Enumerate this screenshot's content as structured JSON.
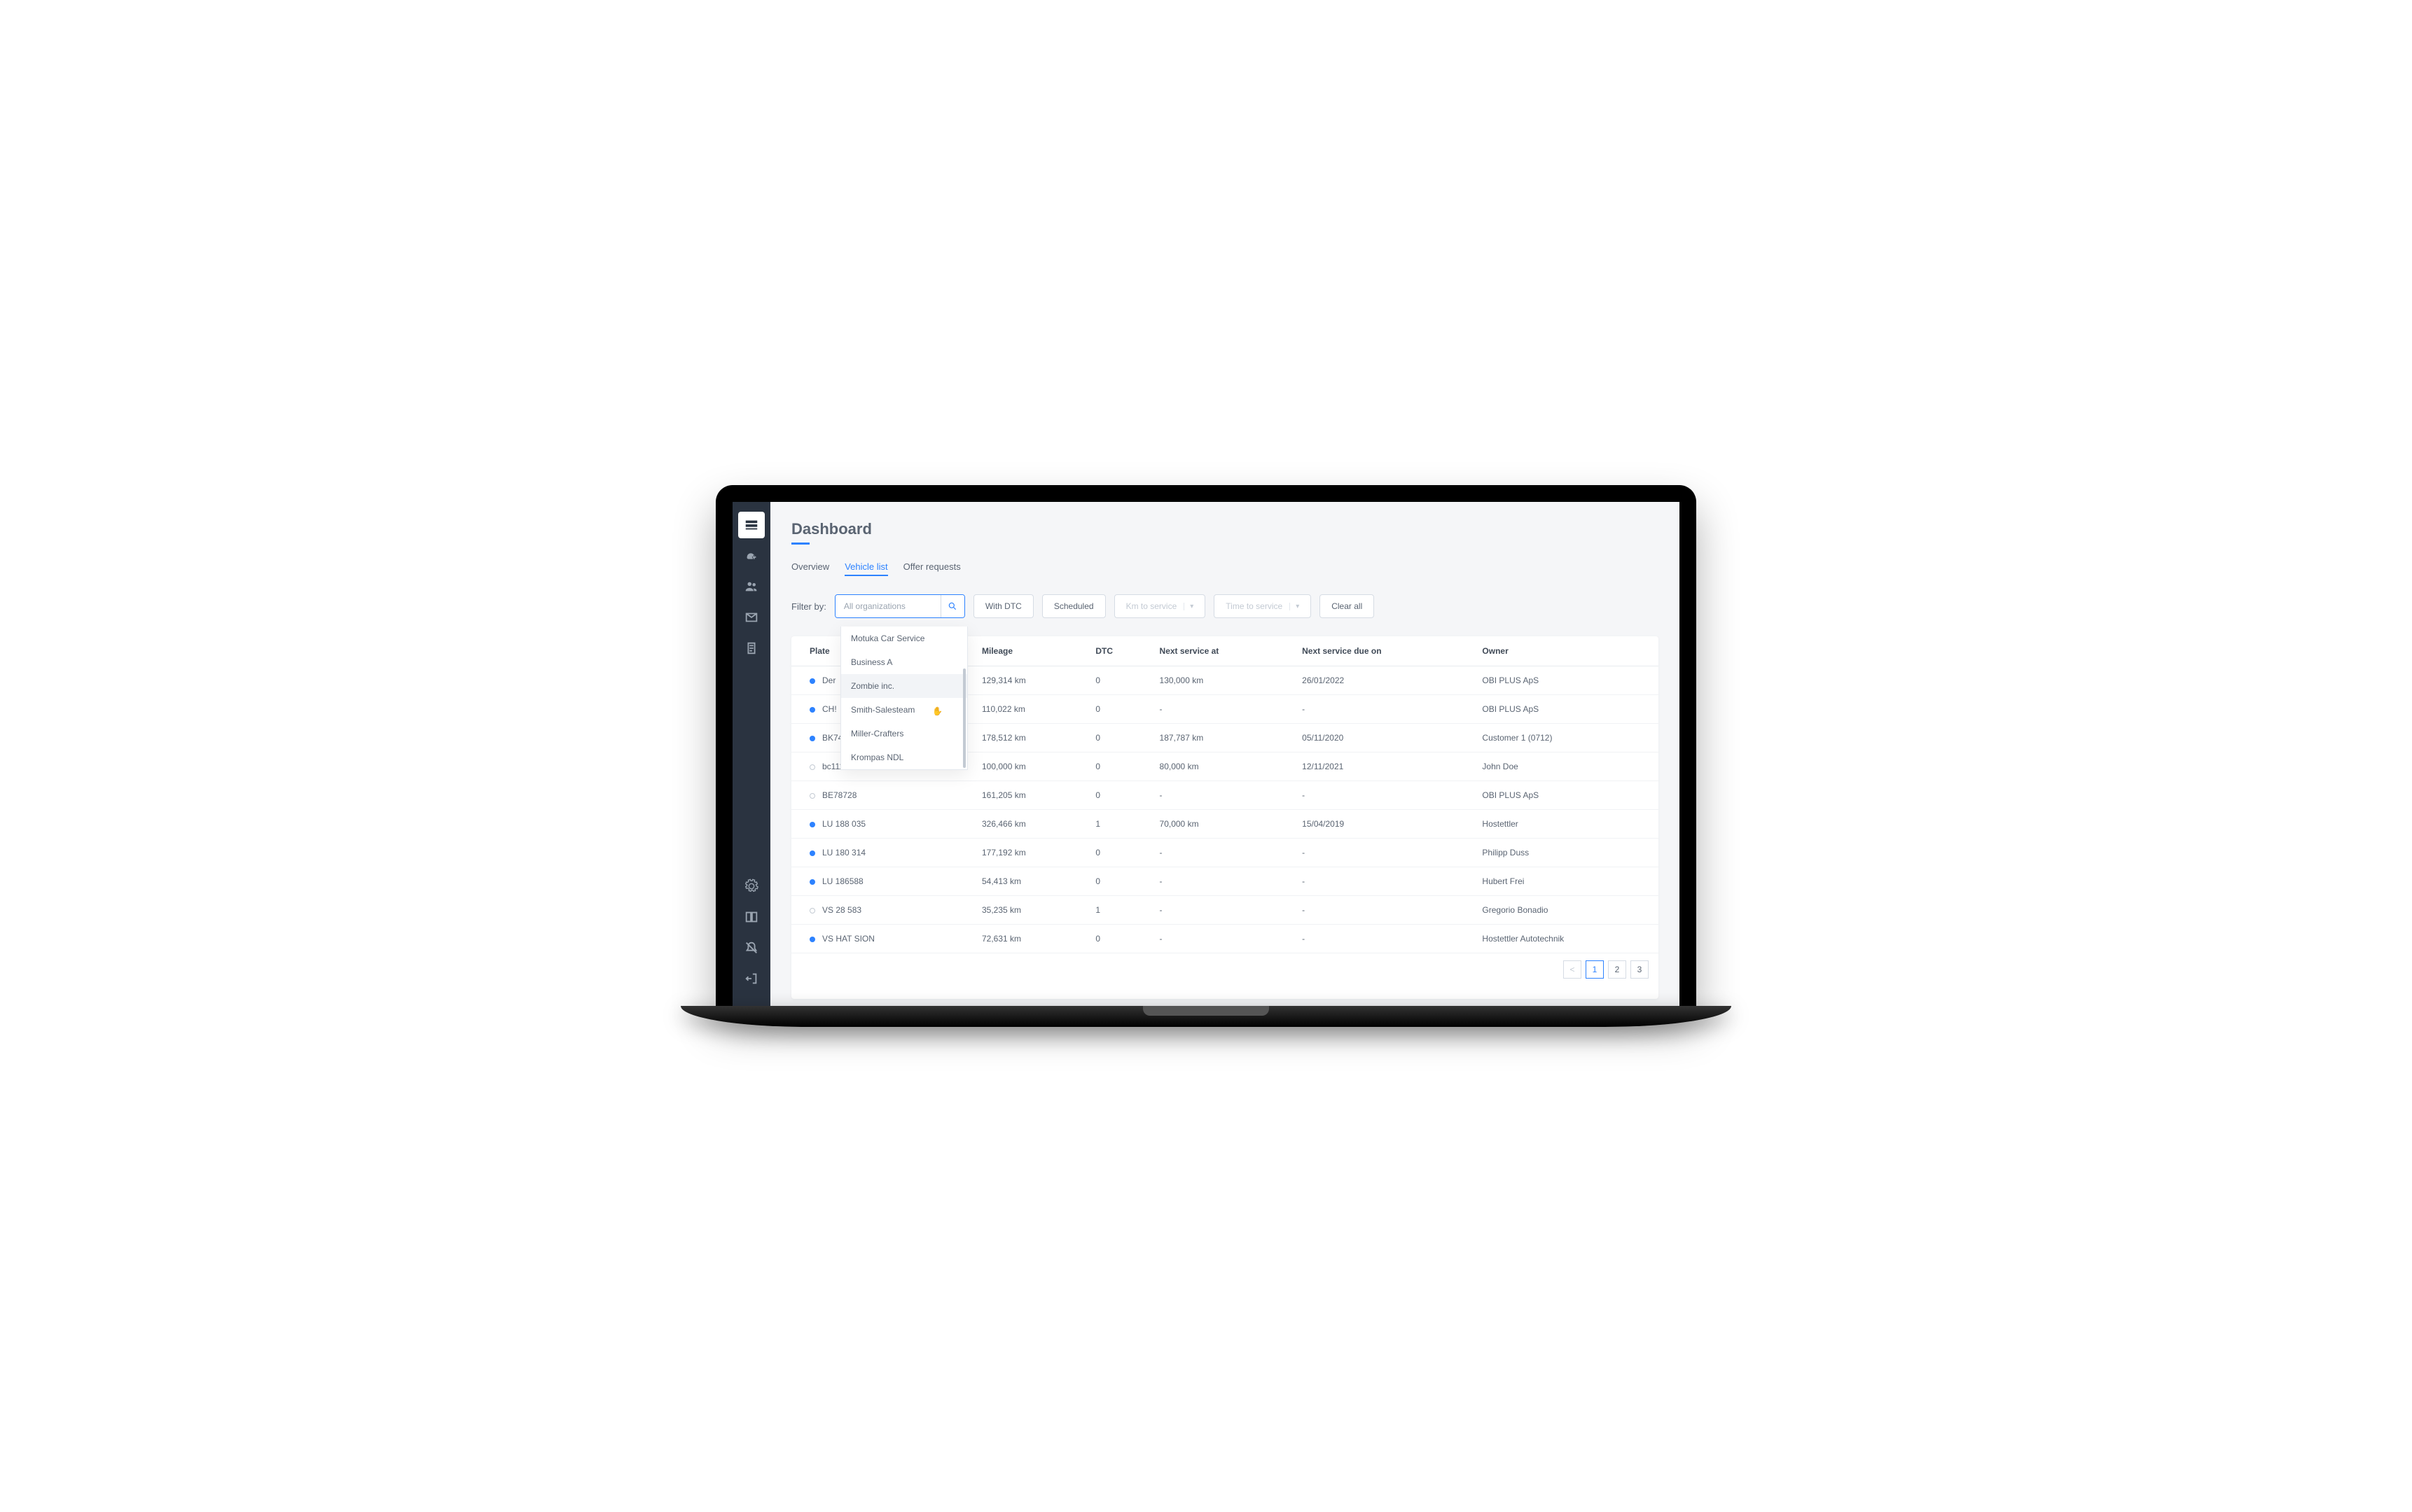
{
  "page": {
    "title": "Dashboard"
  },
  "tabs": [
    {
      "label": "Overview",
      "active": false
    },
    {
      "label": "Vehicle list",
      "active": true
    },
    {
      "label": "Offer requests",
      "active": false
    }
  ],
  "filter": {
    "label": "Filter by:",
    "placeholder": "All organizations",
    "with_dtc": "With DTC",
    "scheduled": "Scheduled",
    "km_to_service": "Km to service",
    "time_to_service": "Time to service",
    "clear_all": "Clear all"
  },
  "dropdown": {
    "items": [
      "Motuka Car Service",
      "Business A",
      "Zombie inc.",
      "Smith-Salesteam",
      "Miller-Crafters",
      "Krompas NDL"
    ],
    "highlighted_index": 2
  },
  "table": {
    "headers": {
      "plate": "Plate",
      "mileage": "Mileage",
      "dtc": "DTC",
      "next_at": "Next service at",
      "next_due": "Next service due on",
      "owner": "Owner"
    },
    "rows": [
      {
        "dot": "blue",
        "plate": "Der",
        "mileage": "129,314 km",
        "dtc": "0",
        "next_at": "130,000 km",
        "next_due": "26/01/2022",
        "owner": "OBI PLUS ApS"
      },
      {
        "dot": "blue",
        "plate": "CH!",
        "mileage": "110,022 km",
        "dtc": "0",
        "next_at": "-",
        "next_due": "-",
        "owner": "OBI PLUS ApS"
      },
      {
        "dot": "blue",
        "plate": "BK74941",
        "mileage": "178,512 km",
        "dtc": "0",
        "next_at": "187,787 km",
        "next_due": "05/11/2020",
        "owner": "Customer 1 (0712)"
      },
      {
        "dot": "grey",
        "plate": "bc11111",
        "mileage": "100,000 km",
        "dtc": "0",
        "next_at": "80,000 km",
        "next_due": "12/11/2021",
        "owner": "John Doe"
      },
      {
        "dot": "grey",
        "plate": "BE78728",
        "mileage": "161,205 km",
        "dtc": "0",
        "next_at": "-",
        "next_due": "-",
        "owner": "OBI PLUS ApS"
      },
      {
        "dot": "blue",
        "plate": "LU 188 035",
        "mileage": "326,466 km",
        "dtc": "1",
        "next_at": "70,000 km",
        "next_due": "15/04/2019",
        "owner": "Hostettler"
      },
      {
        "dot": "blue",
        "plate": "LU 180 314",
        "mileage": "177,192 km",
        "dtc": "0",
        "next_at": "-",
        "next_due": "-",
        "owner": "Philipp Duss"
      },
      {
        "dot": "blue",
        "plate": "LU 186588",
        "mileage": "54,413 km",
        "dtc": "0",
        "next_at": "-",
        "next_due": "-",
        "owner": "Hubert Frei"
      },
      {
        "dot": "grey",
        "plate": "VS 28 583",
        "mileage": "35,235 km",
        "dtc": "1",
        "next_at": "-",
        "next_due": "-",
        "owner": "Gregorio Bonadio"
      },
      {
        "dot": "blue",
        "plate": "VS HAT SION",
        "mileage": "72,631 km",
        "dtc": "0",
        "next_at": "-",
        "next_due": "-",
        "owner": "Hostettler Autotechnik"
      }
    ]
  },
  "pagination": {
    "prev": "<",
    "p1": "1",
    "p2": "2",
    "p3": "3"
  }
}
